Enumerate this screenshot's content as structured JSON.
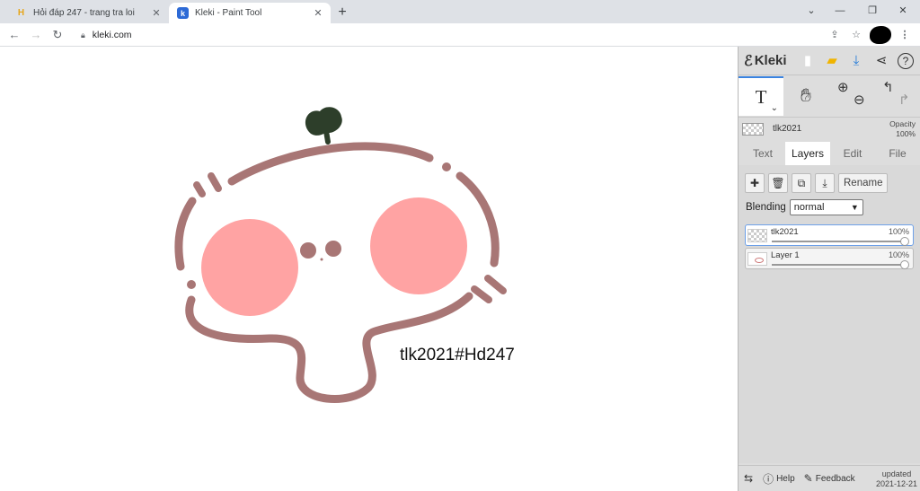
{
  "browser": {
    "tabs": [
      {
        "title": "Hỏi đáp 247 - trang tra loi",
        "favicon": "h247-logo-icon",
        "active": false
      },
      {
        "title": "Kleki - Paint Tool",
        "favicon": "kleki-logo-icon",
        "active": true
      }
    ],
    "url": "kleki.com",
    "new_tab_icon": "+",
    "close_icon": "✕"
  },
  "canvas": {
    "drawn_text": "tlk2021#Hd247",
    "colors": {
      "outline": "#a87675",
      "cheek": "#ffa3a3",
      "leaf": "#2d3e2a"
    }
  },
  "sidebar": {
    "logo_text": "Kleki",
    "layer_name": "tlk2021",
    "opacity_label": "Opacity",
    "opacity_value": "100%",
    "tabs": [
      "Text",
      "Layers",
      "Edit",
      "File"
    ],
    "active_tab": "Layers",
    "rename_label": "Rename",
    "blending_label": "Blending",
    "blending_value": "normal",
    "layers": [
      {
        "name": "tlk2021",
        "opacity": "100%",
        "selected": true
      },
      {
        "name": "Layer 1",
        "opacity": "100%",
        "selected": false
      }
    ],
    "footer": {
      "help_label": "Help",
      "feedback_label": "Feedback",
      "updated_label": "updated",
      "updated_date": "2021-12-21"
    }
  }
}
